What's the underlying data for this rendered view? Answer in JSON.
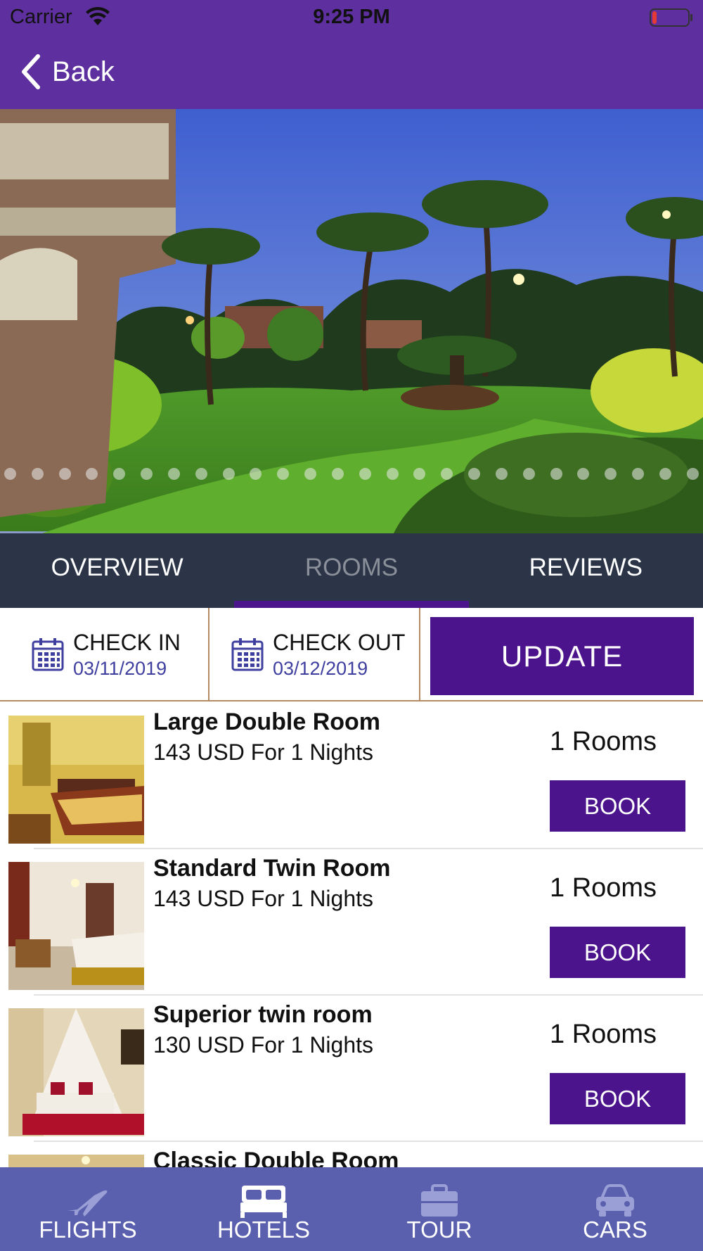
{
  "status_bar": {
    "carrier": "Carrier",
    "time": "9:25 PM",
    "battery_color": "#e53935"
  },
  "nav": {
    "back_label": "Back",
    "color": "#5e2f9e"
  },
  "gallery": {
    "page_count": 26,
    "current_page": 1
  },
  "tabs": [
    {
      "label": "OVERVIEW",
      "active": false
    },
    {
      "label": "ROOMS",
      "active": true
    },
    {
      "label": "REVIEWS",
      "active": false
    }
  ],
  "dates": {
    "check_in_label": "CHECK IN",
    "check_in_value": "03/11/2019",
    "check_out_label": "CHECK OUT",
    "check_out_value": "03/12/2019",
    "update_label": "UPDATE"
  },
  "rooms": [
    {
      "name": "Large Double Room",
      "price": "143 USD For 1 Nights",
      "count": "1 Rooms",
      "book_label": "BOOK"
    },
    {
      "name": "Standard Twin Room",
      "price": "143 USD For 1 Nights",
      "count": "1 Rooms",
      "book_label": "BOOK"
    },
    {
      "name": "Superior twin room",
      "price": "130 USD For 1 Nights",
      "count": "1 Rooms",
      "book_label": "BOOK"
    },
    {
      "name": "Classic Double Room",
      "price": "",
      "count": "",
      "book_label": ""
    }
  ],
  "tab_bar": {
    "items": [
      {
        "label": "FLIGHTS",
        "icon": "airplane-icon",
        "active": false
      },
      {
        "label": "HOTELS",
        "icon": "bed-icon",
        "active": true
      },
      {
        "label": "TOUR",
        "icon": "briefcase-icon",
        "active": false
      },
      {
        "label": "CARS",
        "icon": "car-icon",
        "active": false
      }
    ]
  },
  "colors": {
    "accent": "#4c148c",
    "tabs_bg": "#2b3547",
    "tabbar_bg": "#5a5fae",
    "date_value": "#3f3fa0"
  }
}
